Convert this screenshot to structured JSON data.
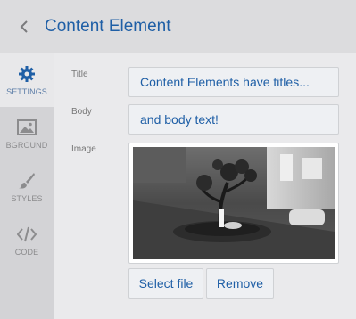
{
  "header": {
    "title": "Content Element"
  },
  "sidebar": {
    "items": [
      {
        "label": "SETTINGS",
        "icon": "gear-icon"
      },
      {
        "label": "BGROUND",
        "icon": "image-icon"
      },
      {
        "label": "STYLES",
        "icon": "brush-icon"
      },
      {
        "label": "CODE",
        "icon": "code-icon"
      }
    ]
  },
  "form": {
    "title_label": "Title",
    "title_value": "Content Elements have titles...",
    "body_label": "Body",
    "body_value": "and body text!",
    "image_label": "Image",
    "select_file_label": "Select file",
    "remove_label": "Remove"
  },
  "colors": {
    "accent": "#1f5fa6",
    "sidebar_bg": "#d3d3d6",
    "header_bg": "#dcdcde"
  }
}
